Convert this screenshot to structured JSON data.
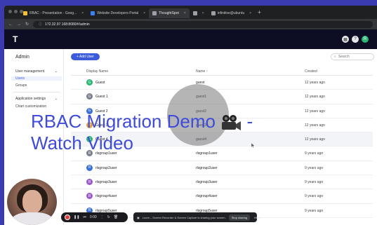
{
  "browser": {
    "tabs": [
      {
        "label": "RBAC - Presentation - Goog...",
        "active": false,
        "favicon": "slides-icon"
      },
      {
        "label": "Website Developers Portal",
        "active": false,
        "favicon": "portal-icon"
      },
      {
        "label": "ThoughtSpot",
        "active": true,
        "favicon": "thoughtspot-icon"
      },
      {
        "label": "",
        "active": false,
        "favicon": "blank-icon"
      },
      {
        "label": "infinitive@ubuntu",
        "active": false,
        "favicon": "terminal-icon"
      }
    ],
    "url": "172.32.97.168:8080/#/admin"
  },
  "header": {
    "logo": "T",
    "avatar_letter": "R"
  },
  "sidebar": {
    "title": "Admin",
    "sections": [
      {
        "label": "User management",
        "items": [
          "Users",
          "Groups"
        ]
      },
      {
        "label": "Application settings",
        "items": [
          "Chart customization"
        ]
      }
    ],
    "selected": "Users"
  },
  "toolbar": {
    "add_user_label": "+ Add User",
    "search_placeholder": "Search"
  },
  "table": {
    "columns": [
      "Display Name",
      "Name ↑",
      "Created"
    ],
    "rows": [
      {
        "initial": "G",
        "color": "#2bb673",
        "display": "Guest",
        "name": "guest",
        "created": "12 years ago"
      },
      {
        "initial": "G",
        "color": "#7a7f8c",
        "display": "Guest 1",
        "name": "guest1",
        "created": "12 years ago"
      },
      {
        "initial": "G",
        "color": "#3b6fd9",
        "display": "Guest 2",
        "name": "guest2",
        "created": "12 years ago"
      },
      {
        "initial": "G",
        "color": "#e2a13a",
        "display": "Guest 3",
        "name": "guest3",
        "created": "12 years ago"
      },
      {
        "initial": "G",
        "color": "#2bb673",
        "display": "Guest 4",
        "name": "guest4",
        "created": "12 years ago"
      },
      {
        "initial": "R",
        "color": "#7a7f8c",
        "display": "rlsgroup1user",
        "name": "rlsgroup1user",
        "created": "9 years ago"
      },
      {
        "initial": "R",
        "color": "#3b6fd9",
        "display": "rlsgroup2user",
        "name": "rlsgroup2user",
        "created": "9 years ago"
      },
      {
        "initial": "R",
        "color": "#9b59d0",
        "display": "rlsgroup3user",
        "name": "rlsgroup3user",
        "created": "9 years ago"
      },
      {
        "initial": "R",
        "color": "#9b59d0",
        "display": "rlsgroup4user",
        "name": "rlsgroup4user",
        "created": "9 years ago"
      },
      {
        "initial": "R",
        "color": "#3b6fd9",
        "display": "rlsgroup5user",
        "name": "rlsgroup5user",
        "created": "9 years ago"
      }
    ],
    "highlighted_row": 4
  },
  "overlay": {
    "caption_line1": "RBAC Migration Demo",
    "caption_line2": "- Watch Video",
    "camera_icon": "movie-camera-icon"
  },
  "recorder": {
    "time": "0:00"
  },
  "share_bar": {
    "message": "Loom – Screen Recorder & Screen Capture is sharing your screen.",
    "stop_label": "Stop sharing",
    "hide_label": "Hide"
  },
  "colors": {
    "accent": "#3b5bdb",
    "caption": "#3f4bd9",
    "header_bg": "#0d0e24"
  }
}
